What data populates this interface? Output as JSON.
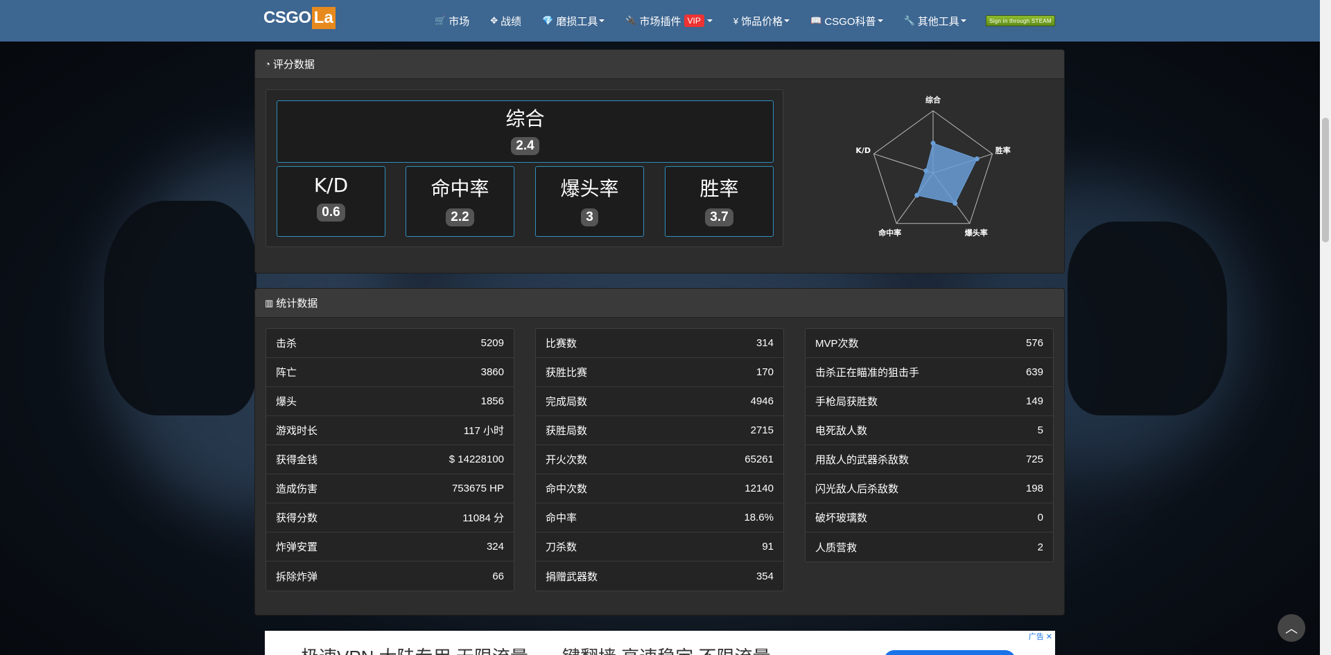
{
  "nav": {
    "logo_main": "CSGO",
    "logo_accent": "La",
    "items": [
      {
        "label": "市场",
        "icon": "cart-icon",
        "glyph": "🛒",
        "caret": false
      },
      {
        "label": "战绩",
        "icon": "crosshair-icon",
        "glyph": "✥",
        "caret": false
      },
      {
        "label": "磨损工具",
        "icon": "diamond-icon",
        "glyph": "💎",
        "caret": true
      },
      {
        "label": "市场插件",
        "icon": "plug-icon",
        "glyph": "🔌",
        "caret": true,
        "badge": "VIP"
      },
      {
        "label": "饰品价格",
        "icon": "yen-icon",
        "glyph": "¥",
        "caret": true
      },
      {
        "label": "CSGO科普",
        "icon": "book-icon",
        "glyph": "📖",
        "caret": true
      },
      {
        "label": "其他工具",
        "icon": "wrench-icon",
        "glyph": "🔧",
        "caret": true
      }
    ],
    "steam_label": "Sign in through STEAM"
  },
  "score_panel": {
    "title": "评分数据",
    "overall": {
      "label": "综合",
      "value": "2.4"
    },
    "metrics": [
      {
        "label": "K/D",
        "value": "0.6"
      },
      {
        "label": "命中率",
        "value": "2.2"
      },
      {
        "label": "爆头率",
        "value": "3"
      },
      {
        "label": "胜率",
        "value": "3.7"
      }
    ]
  },
  "chart_data": {
    "type": "radar",
    "axes": [
      "综合",
      "胜率",
      "爆头率",
      "命中率",
      "K/D"
    ],
    "values": [
      2.4,
      3.7,
      3,
      2.2,
      0.6
    ],
    "max": 5,
    "color": "#6a9fd8"
  },
  "stats_panel": {
    "title": "统计数据",
    "columns": [
      [
        {
          "label": "击杀",
          "value": "5209"
        },
        {
          "label": "阵亡",
          "value": "3860"
        },
        {
          "label": "爆头",
          "value": "1856"
        },
        {
          "label": "游戏时长",
          "value": "117 小时"
        },
        {
          "label": "获得金钱",
          "value": "$ 14228100"
        },
        {
          "label": "造成伤害",
          "value": "753675 HP"
        },
        {
          "label": "获得分数",
          "value": "11084 分"
        },
        {
          "label": "炸弹安置",
          "value": "324"
        },
        {
          "label": "拆除炸弹",
          "value": "66"
        }
      ],
      [
        {
          "label": "比赛数",
          "value": "314"
        },
        {
          "label": "获胜比赛",
          "value": "170"
        },
        {
          "label": "完成局数",
          "value": "4946"
        },
        {
          "label": "获胜局数",
          "value": "2715"
        },
        {
          "label": "开火次数",
          "value": "65261"
        },
        {
          "label": "命中次数",
          "value": "12140"
        },
        {
          "label": "命中率",
          "value": "18.6%"
        },
        {
          "label": "刀杀数",
          "value": "91"
        },
        {
          "label": "捐赠武器数",
          "value": "354"
        }
      ],
      [
        {
          "label": "MVP次数",
          "value": "576"
        },
        {
          "label": "击杀正在瞄准的狙击手",
          "value": "639"
        },
        {
          "label": "手枪局获胜数",
          "value": "149"
        },
        {
          "label": "电死敌人数",
          "value": "5"
        },
        {
          "label": "用敌人的武器杀敌数",
          "value": "725"
        },
        {
          "label": "闪光敌人后杀敌数",
          "value": "198"
        },
        {
          "label": "破坏玻璃数",
          "value": "0"
        },
        {
          "label": "人质营救",
          "value": "2"
        }
      ]
    ]
  },
  "ad": {
    "text": "极速VPN 大陆专用 无限流量 - 一键翻墙 高速稳定 不限流量",
    "tag": "广告"
  }
}
